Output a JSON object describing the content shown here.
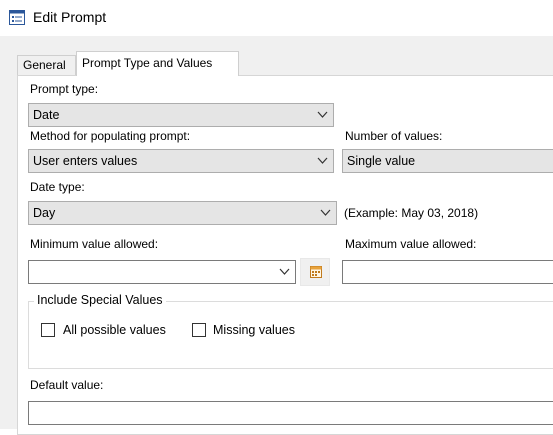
{
  "window": {
    "title": "Edit Prompt",
    "icon": "list-window-icon"
  },
  "tabs": [
    {
      "label": "General",
      "active": false
    },
    {
      "label": "Prompt Type and Values",
      "active": true
    }
  ],
  "form": {
    "prompt_type": {
      "label": "Prompt type:",
      "value": "Date"
    },
    "method": {
      "label": "Method for populating prompt:",
      "value": "User enters values"
    },
    "number_of_values": {
      "label": "Number of values:",
      "value": "Single value"
    },
    "date_type": {
      "label": "Date type:",
      "value": "Day",
      "example": "(Example: May 03, 2018)"
    },
    "minimum": {
      "label": "Minimum value allowed:",
      "value": ""
    },
    "maximum": {
      "label": "Maximum value allowed:",
      "value": ""
    },
    "special_values": {
      "legend": "Include Special Values",
      "all_possible": {
        "label": "All possible values",
        "checked": false
      },
      "missing": {
        "label": "Missing values",
        "checked": false
      }
    },
    "default_value": {
      "label": "Default value:",
      "value": ""
    }
  },
  "colors": {
    "combo_bg": "#e5e5e5",
    "panel_bg": "#ffffff",
    "window_bg": "#f0f0f0",
    "calendar_accent": "#e8a23a"
  }
}
